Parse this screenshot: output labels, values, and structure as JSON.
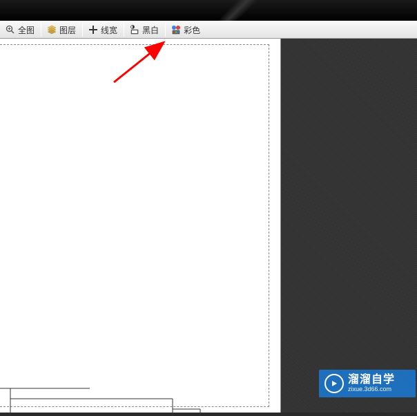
{
  "toolbar": {
    "buttons": [
      {
        "label": "全图",
        "icon": "zoom-all-icon"
      },
      {
        "label": "图层",
        "icon": "layers-icon"
      },
      {
        "label": "线宽",
        "icon": "line-width-icon"
      },
      {
        "label": "黑白",
        "icon": "blackwhite-icon"
      },
      {
        "label": "彩色",
        "icon": "color-icon"
      }
    ]
  },
  "watermark": {
    "main_text": "溜溜自学",
    "sub_text": "zixue.3d66.com"
  }
}
